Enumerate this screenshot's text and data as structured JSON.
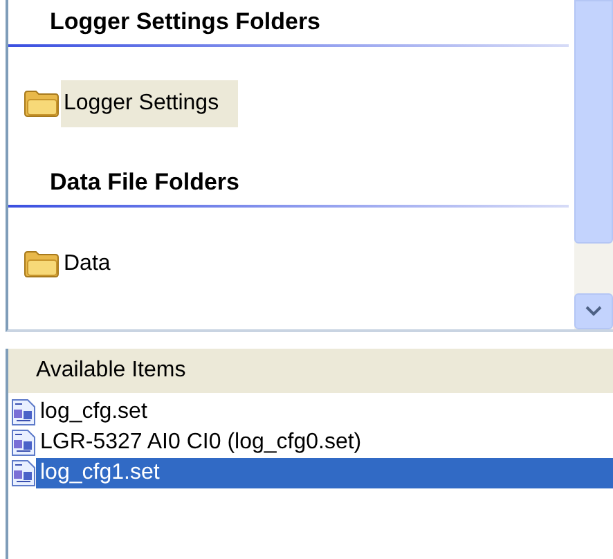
{
  "folder_sections": [
    {
      "heading": "Logger Settings Folders",
      "folders": [
        {
          "label": "Logger Settings",
          "selected": true
        }
      ]
    },
    {
      "heading": "Data File Folders",
      "folders": [
        {
          "label": "Data",
          "selected": false
        }
      ]
    }
  ],
  "available_items": {
    "header": "Available Items",
    "items": [
      {
        "label": "log_cfg.set",
        "selected": false
      },
      {
        "label": "LGR-5327 AI0 CI0 (log_cfg0.set)",
        "selected": false
      },
      {
        "label": "log_cfg1.set",
        "selected": true
      }
    ]
  }
}
